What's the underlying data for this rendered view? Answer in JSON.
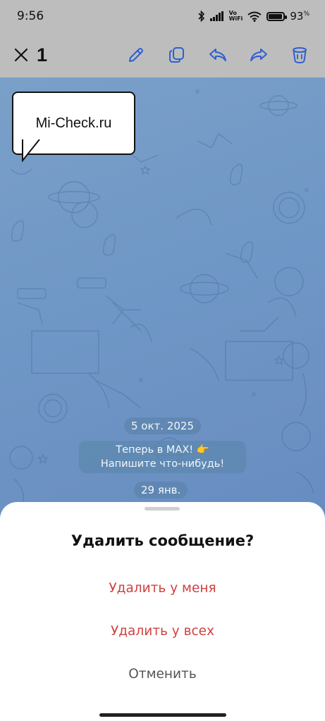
{
  "status_bar": {
    "time": "9:56",
    "volte_top": "Vo",
    "volte_bottom": "WiFi",
    "battery_percent": "93",
    "battery_unit": "%",
    "battery_level": 0.93,
    "icons": [
      "bluetooth-icon",
      "signal-icon",
      "volte-icon",
      "wifi-icon",
      "battery-icon"
    ]
  },
  "toolbar": {
    "selected_count": "1",
    "actions": [
      "close-icon",
      "edit-icon",
      "copy-icon",
      "reply-icon",
      "forward-icon",
      "delete-icon"
    ],
    "accent_color": "#2f5fd0"
  },
  "watermark": {
    "text": "Mi-Check.ru"
  },
  "chat": {
    "date_1": "5 окт. 2025",
    "system_message_line1": "Теперь в MAX! 👉",
    "system_message_line2": "Напишите что-нибудь!",
    "date_2": "29 янв."
  },
  "delete_sheet": {
    "title": "Удалить сообщение?",
    "delete_for_me": "Удалить у меня",
    "delete_for_all": "Удалить у всех",
    "cancel": "Отменить",
    "danger_color": "#d0423f"
  }
}
